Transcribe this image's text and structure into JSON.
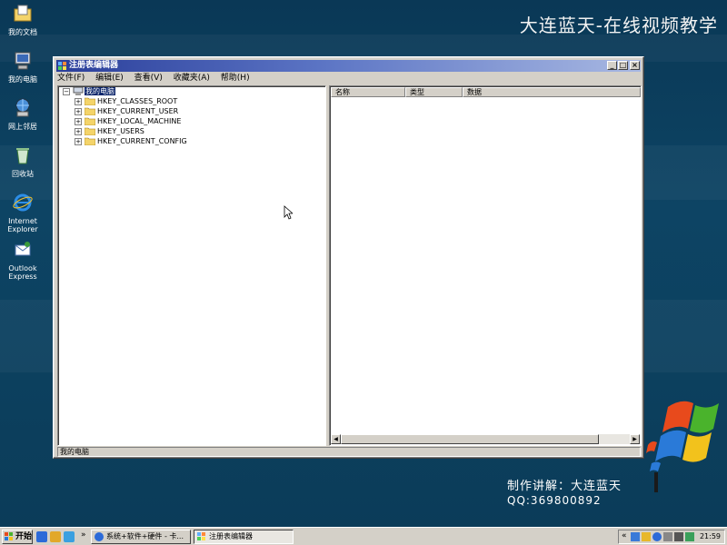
{
  "desktop": {
    "watermark": "大连蓝天-在线视频教学",
    "credit": "制作讲解：大连蓝天",
    "qq": "QQ:369800892",
    "icons": [
      {
        "label": "我的文档",
        "icon": "my-documents-icon"
      },
      {
        "label": "我的电脑",
        "icon": "my-computer-icon"
      },
      {
        "label": "网上邻居",
        "icon": "network-places-icon"
      },
      {
        "label": "回收站",
        "icon": "recycle-bin-icon"
      },
      {
        "label": "Internet Explorer",
        "icon": "internet-explorer-icon"
      },
      {
        "label": "Outlook Express",
        "icon": "outlook-express-icon"
      }
    ]
  },
  "window": {
    "title": "注册表编辑器",
    "controls": {
      "minimize": "_",
      "maximize": "□",
      "close": "×"
    },
    "menu": [
      "文件(F)",
      "编辑(E)",
      "查看(V)",
      "收藏夹(A)",
      "帮助(H)"
    ],
    "tree": {
      "root": "我的电脑",
      "keys": [
        "HKEY_CLASSES_ROOT",
        "HKEY_CURRENT_USER",
        "HKEY_LOCAL_MACHINE",
        "HKEY_USERS",
        "HKEY_CURRENT_CONFIG"
      ]
    },
    "columns": [
      "名称",
      "类型",
      "数据"
    ],
    "status": "我的电脑"
  },
  "taskbar": {
    "start": "开始",
    "tasks": [
      {
        "label": "系统+软件+硬件 - 卡..."
      },
      {
        "label": "注册表编辑器"
      }
    ],
    "tray_chevron": "«",
    "clock": "21:59",
    "taskbar_chevron": "»"
  },
  "colors": {
    "desktop": "#0c3f5c",
    "titlebar_start": "#2a3e9a",
    "selection": "#0a246a",
    "face": "#d4d0c8"
  }
}
